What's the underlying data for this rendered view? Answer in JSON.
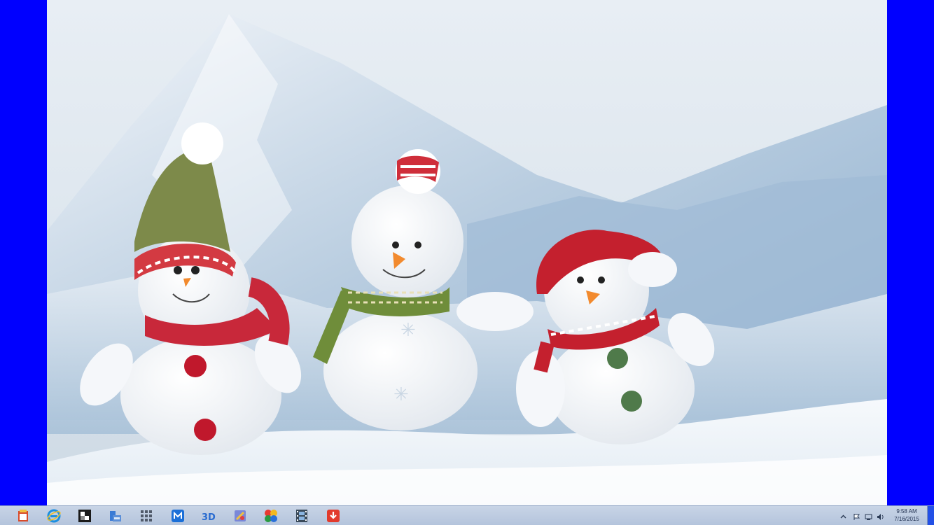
{
  "desktop": {
    "wallpaper": "snowmen-in-snow-wallpaper",
    "side_color": "#0000ff"
  },
  "taskbar": {
    "background": "#bccade",
    "pinned": [
      {
        "name": "file-manager-icon"
      },
      {
        "name": "internet-explorer-icon"
      },
      {
        "name": "windows-store-icon"
      },
      {
        "name": "file-explorer-icon"
      },
      {
        "name": "control-grid-icon"
      },
      {
        "name": "maxthon-browser-icon"
      },
      {
        "name": "3d-viewer-icon"
      },
      {
        "name": "paint-app-icon"
      },
      {
        "name": "pinwheel-app-icon"
      },
      {
        "name": "film-strip-icon"
      },
      {
        "name": "download-manager-icon"
      }
    ],
    "tray": {
      "icons": [
        "chevron-up-icon",
        "flag-icon",
        "network-icon",
        "speaker-icon"
      ],
      "time": "9:58 AM",
      "date": "7/16/2015"
    }
  }
}
